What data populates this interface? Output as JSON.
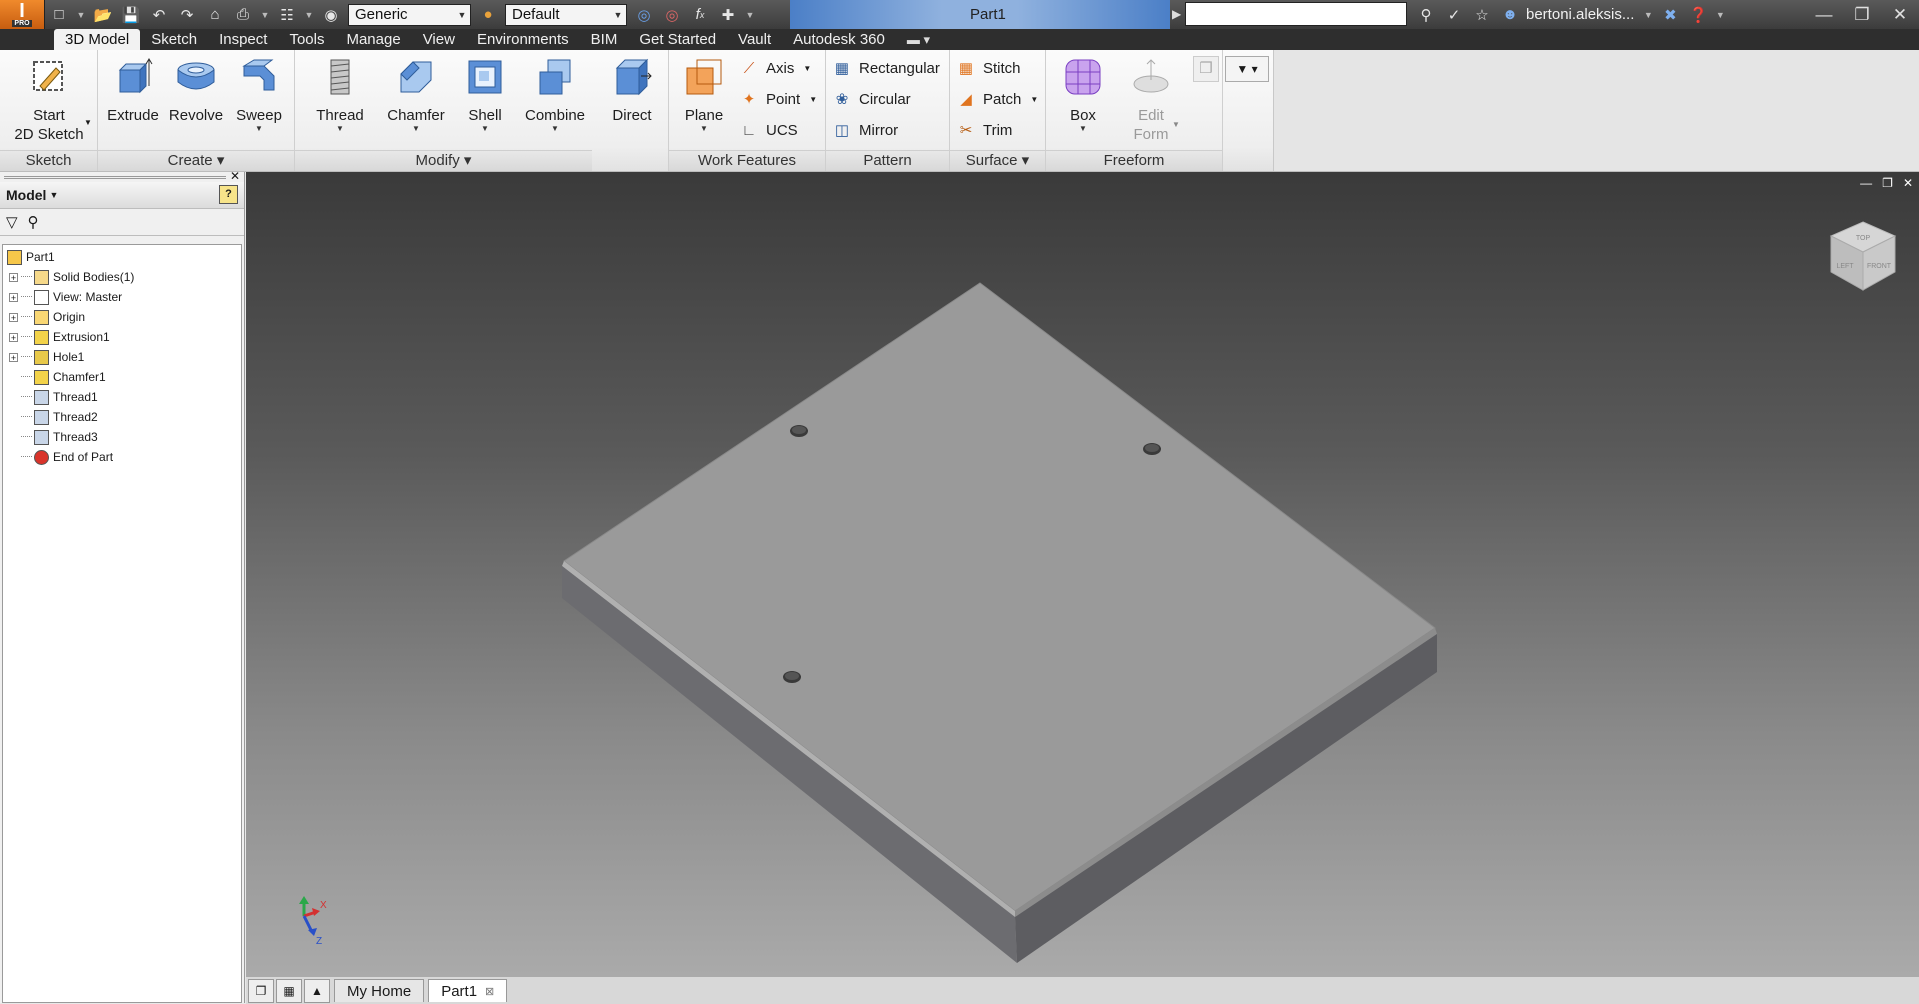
{
  "app": {
    "logo_letter": "I",
    "logo_badge": "PRO",
    "document_title": "Part1",
    "user_name": "bertoni.aleksis...",
    "material": "Generic",
    "appearance": "Default",
    "search_placeholder": ""
  },
  "tabs": [
    "3D Model",
    "Sketch",
    "Inspect",
    "Tools",
    "Manage",
    "View",
    "Environments",
    "BIM",
    "Get Started",
    "Vault",
    "Autodesk 360"
  ],
  "ribbon": {
    "sketch": {
      "label": "Sketch",
      "start_line1": "Start",
      "start_line2": "2D Sketch"
    },
    "create": {
      "label": "Create",
      "extrude": "Extrude",
      "revolve": "Revolve",
      "sweep": "Sweep"
    },
    "modify": {
      "label": "Modify",
      "thread": "Thread",
      "chamfer": "Chamfer",
      "shell": "Shell",
      "combine": "Combine",
      "direct": "Direct"
    },
    "work": {
      "label": "Work Features",
      "plane": "Plane",
      "axis": "Axis",
      "point": "Point",
      "ucs": "UCS"
    },
    "pattern": {
      "label": "Pattern",
      "rectangular": "Rectangular",
      "circular": "Circular",
      "mirror": "Mirror"
    },
    "surface": {
      "label": "Surface",
      "stitch": "Stitch",
      "patch": "Patch",
      "trim": "Trim"
    },
    "freeform": {
      "label": "Freeform",
      "box": "Box",
      "edit_line1": "Edit",
      "edit_line2": "Form"
    }
  },
  "browser": {
    "title": "Model",
    "help": "?",
    "tree": [
      "Part1",
      "Solid Bodies(1)",
      "View: Master",
      "Origin",
      "Extrusion1",
      "Hole1",
      "Chamfer1",
      "Thread1",
      "Thread2",
      "Thread3",
      "End of Part"
    ]
  },
  "viewcube": {
    "top": "TOP",
    "left": "LEFT",
    "front": "FRONT"
  },
  "triad": {
    "x": "X",
    "z": "Z"
  },
  "doc_tabs": [
    "My Home",
    "Part1"
  ],
  "colors": {
    "accent_orange": "#e0741f",
    "viewport_top": "#3a3a3a",
    "viewport_bottom": "#aaaaaa",
    "part_face": "#999999"
  }
}
